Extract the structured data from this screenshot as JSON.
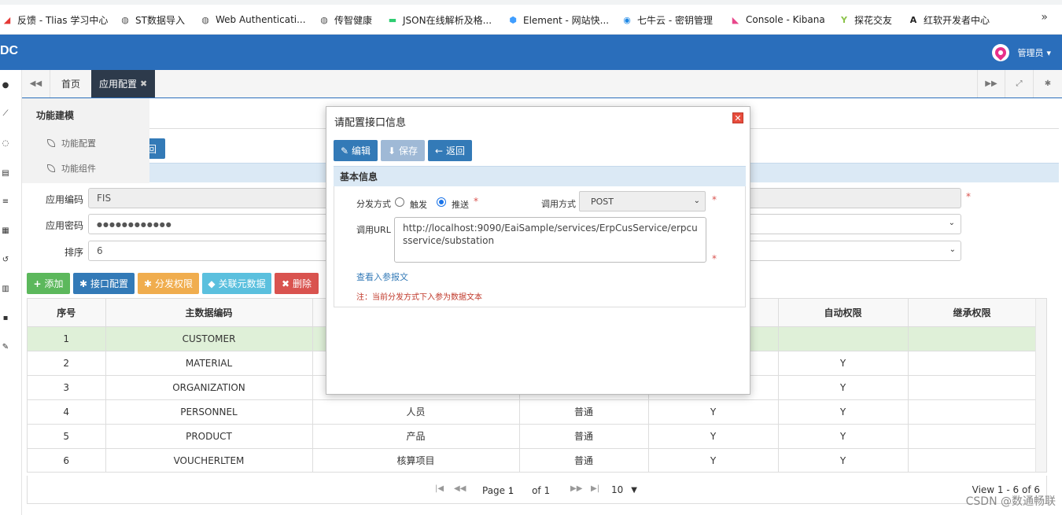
{
  "bookmarks": [
    {
      "label": "反馈 - Tlias 学习中心",
      "icon": "feedback-icon",
      "color": "#e53935"
    },
    {
      "label": "ST数据导入",
      "icon": "globe-icon",
      "color": "#555555"
    },
    {
      "label": "Web Authenticati...",
      "icon": "globe-icon",
      "color": "#555555"
    },
    {
      "label": "传智健康",
      "icon": "globe-icon",
      "color": "#555555"
    },
    {
      "label": "JSON在线解析及格...",
      "icon": "json-icon",
      "color": "#2ecc71"
    },
    {
      "label": "Element - 网站快...",
      "icon": "element-icon",
      "color": "#409eff"
    },
    {
      "label": "七牛云 - 密钥管理",
      "icon": "qiniu-icon",
      "color": "#1e88e5"
    },
    {
      "label": "Console - Kibana",
      "icon": "kibana-icon",
      "color": "#e8478b"
    },
    {
      "label": "探花交友",
      "icon": "tanhua-icon",
      "color": "#8bc34a"
    },
    {
      "label": "红软开发者中心",
      "icon": "hongruan-icon",
      "color": "#222222"
    }
  ],
  "header": {
    "logo": "DC",
    "user": "管理员",
    "user_caret": "▾",
    "color": "#2a6ebb"
  },
  "tabs": {
    "home": "首页",
    "active": "应用配置",
    "close": "✖"
  },
  "flyout": {
    "title": "功能建模",
    "items": [
      "功能配置",
      "功能组件"
    ]
  },
  "page": {
    "back_label": "回",
    "labels": {
      "code": "应用编码",
      "secret": "应用密码",
      "order": "排序"
    },
    "values": {
      "code": "FIS",
      "secret": "●●●●●●●●●●●●",
      "order": "6"
    },
    "required_mark": "*"
  },
  "toolbar": {
    "add": "添加",
    "interface": "接口配置",
    "perm": "分发权限",
    "meta": "关联元数据",
    "delete": "删除",
    "colors": {
      "add": "#5cb85c",
      "interface": "#337ab7",
      "perm": "#f0ad4e",
      "meta": "#5bc0de",
      "delete": "#d9534f"
    }
  },
  "grid": {
    "headers": [
      "序号",
      "主数据编码",
      "",
      "",
      "",
      "自动权限",
      "继承权限"
    ],
    "rows": [
      [
        "1",
        "CUSTOMER",
        "",
        "",
        "",
        "",
        ""
      ],
      [
        "2",
        "MATERIAL",
        "",
        "",
        "",
        "Y",
        ""
      ],
      [
        "3",
        "ORGANIZATION",
        "",
        "",
        "",
        "Y",
        ""
      ],
      [
        "4",
        "PERSONNEL",
        "人员",
        "普通",
        "Y",
        "Y",
        ""
      ],
      [
        "5",
        "PRODUCT",
        "产品",
        "普通",
        "Y",
        "Y",
        ""
      ],
      [
        "6",
        "VOUCHERLTEM",
        "核算项目",
        "普通",
        "Y",
        "Y",
        ""
      ]
    ],
    "selected_row": 0
  },
  "pager": {
    "page_label": "Page",
    "page_value": "1",
    "of_label": "of 1",
    "size": "10",
    "view": "View 1 - 6 of 6"
  },
  "watermark": "CSDN @数通畅联",
  "modal": {
    "title": "请配置接口信息",
    "close": "✕",
    "buttons": {
      "edit": "编辑",
      "save": "保存",
      "back": "返回"
    },
    "section": "基本信息",
    "dispatch_label": "分发方式",
    "radio_trigger": "触发",
    "radio_push": "推送",
    "call_label": "调用方式",
    "call_value": "POST",
    "url_label": "调用URL",
    "url_value": "http://localhost:9090/EaiSample/services/ErpCusService/erpcusservice/substation",
    "link": "查看入参报文",
    "note": "注：当前分发方式下入参为数据文本"
  }
}
